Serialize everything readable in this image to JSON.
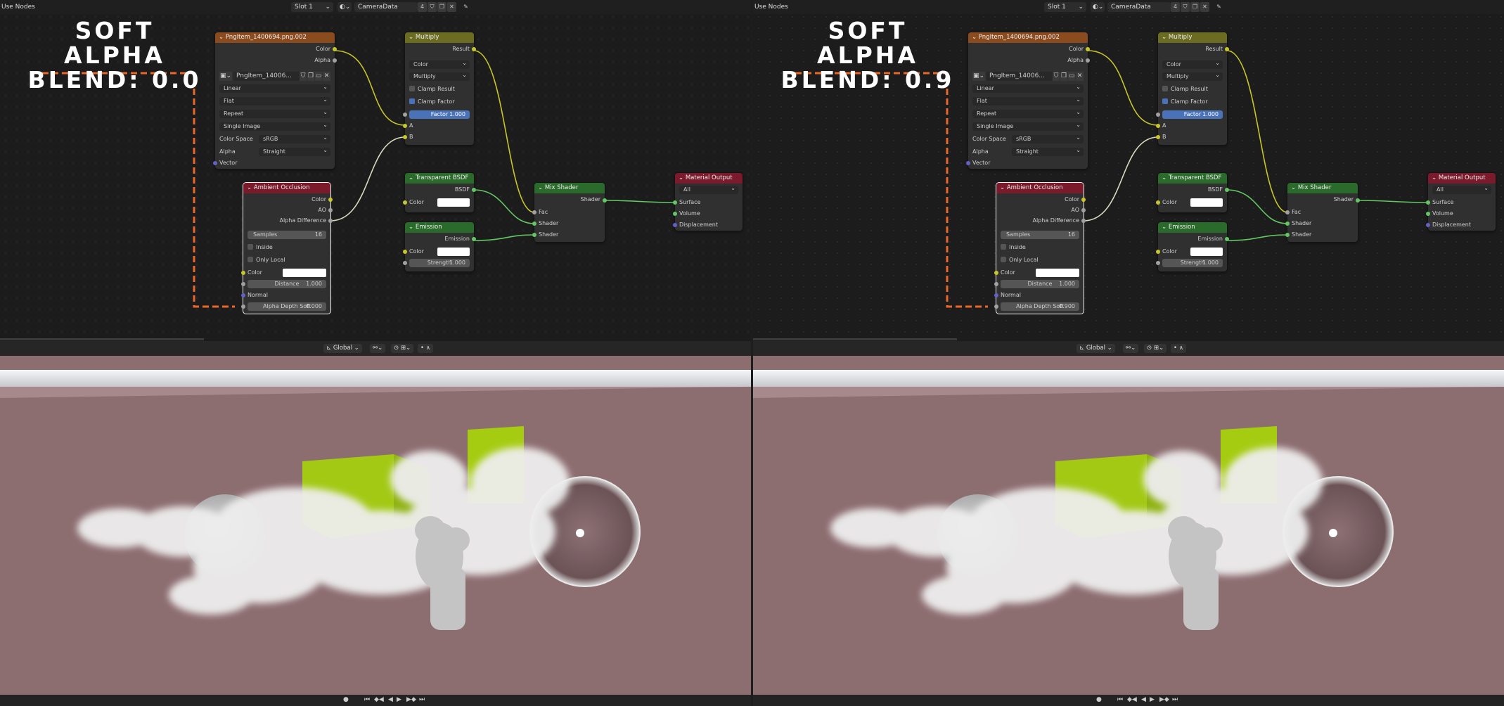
{
  "panels": [
    {
      "header": {
        "title": "Use Nodes",
        "slot": "Slot 1",
        "camera_data": "CameraData",
        "user_count": "4"
      },
      "overlay_text": [
        "SOFT ALPHA",
        "BLEND: 0.0"
      ],
      "image_node": {
        "title": "PngItem_1400694.png.002",
        "out_color": "Color",
        "out_alpha": "Alpha",
        "image_name": "PngItem_14006...",
        "interpolation": "Linear",
        "projection": "Flat",
        "extension": "Repeat",
        "source": "Single Image",
        "color_space_label": "Color Space",
        "color_space_value": "sRGB",
        "alpha_label": "Alpha",
        "alpha_value": "Straight",
        "in_vector": "Vector"
      },
      "multiply_node": {
        "title": "Multiply",
        "out_result": "Result",
        "type": "Color",
        "blend": "Multiply",
        "clamp_result": "Clamp Result",
        "clamp_factor": "Clamp Factor",
        "factor_label": "Factor",
        "factor_value": "1.000",
        "in_a": "A",
        "in_b": "B"
      },
      "ao_node": {
        "title": "Ambient Occlusion",
        "out_color": "Color",
        "out_ao": "AO",
        "out_alpha_diff": "Alpha Difference",
        "samples_label": "Samples",
        "samples_value": "16",
        "inside": "Inside",
        "only_local": "Only Local",
        "color_label": "Color",
        "distance_label": "Distance",
        "distance_value": "1.000",
        "normal": "Normal",
        "alpha_depth_label": "Alpha Depth Soft",
        "alpha_depth_value": "0.000"
      },
      "transparent_node": {
        "title": "Transparent BSDF",
        "out_bsdf": "BSDF",
        "color_label": "Color"
      },
      "emission_node": {
        "title": "Emission",
        "out_emission": "Emission",
        "color_label": "Color",
        "strength_label": "Strength",
        "strength_value": "1.000"
      },
      "mix_node": {
        "title": "Mix Shader",
        "out_shader": "Shader",
        "in_fac": "Fac",
        "in_shader1": "Shader",
        "in_shader2": "Shader"
      },
      "output_node": {
        "title": "Material Output",
        "target": "All",
        "in_surface": "Surface",
        "in_volume": "Volume",
        "in_displacement": "Displacement"
      },
      "viewport_header": {
        "orientation": "Global"
      }
    },
    {
      "header": {
        "title": "Use Nodes",
        "slot": "Slot 1",
        "camera_data": "CameraData",
        "user_count": "4"
      },
      "overlay_text": [
        "SOFT ALPHA",
        "BLEND: 0.9"
      ],
      "image_node": {
        "title": "PngItem_1400694.png.002",
        "out_color": "Color",
        "out_alpha": "Alpha",
        "image_name": "PngItem_14006...",
        "interpolation": "Linear",
        "projection": "Flat",
        "extension": "Repeat",
        "source": "Single Image",
        "color_space_label": "Color Space",
        "color_space_value": "sRGB",
        "alpha_label": "Alpha",
        "alpha_value": "Straight",
        "in_vector": "Vector"
      },
      "multiply_node": {
        "title": "Multiply",
        "out_result": "Result",
        "type": "Color",
        "blend": "Multiply",
        "clamp_result": "Clamp Result",
        "clamp_factor": "Clamp Factor",
        "factor_label": "Factor",
        "factor_value": "1.000",
        "in_a": "A",
        "in_b": "B"
      },
      "ao_node": {
        "title": "Ambient Occlusion",
        "out_color": "Color",
        "out_ao": "AO",
        "out_alpha_diff": "Alpha Difference",
        "samples_label": "Samples",
        "samples_value": "16",
        "inside": "Inside",
        "only_local": "Only Local",
        "color_label": "Color",
        "distance_label": "Distance",
        "distance_value": "1.000",
        "normal": "Normal",
        "alpha_depth_label": "Alpha Depth Soft",
        "alpha_depth_value": "0.900"
      },
      "transparent_node": {
        "title": "Transparent BSDF",
        "out_bsdf": "BSDF",
        "color_label": "Color"
      },
      "emission_node": {
        "title": "Emission",
        "out_emission": "Emission",
        "color_label": "Color",
        "strength_label": "Strength",
        "strength_value": "1.000"
      },
      "mix_node": {
        "title": "Mix Shader",
        "out_shader": "Shader",
        "in_fac": "Fac",
        "in_shader1": "Shader",
        "in_shader2": "Shader"
      },
      "output_node": {
        "title": "Material Output",
        "target": "All",
        "in_surface": "Surface",
        "in_volume": "Volume",
        "in_displacement": "Displacement"
      },
      "viewport_header": {
        "orientation": "Global"
      }
    }
  ],
  "colors": {
    "annotation_orange": "#e8682a",
    "image_header": "#8a4b1f",
    "converter_header": "#6b6b22",
    "shader_header": "#2a6a2a",
    "output_header": "#7a1a2a",
    "floor": "#8a6b6e",
    "cube": "#a6cc12"
  },
  "icons": [
    "chevron-down-icon",
    "material-sphere-icon",
    "shield-icon",
    "copy-icon",
    "close-icon",
    "pin-icon",
    "image-icon",
    "folder-icon",
    "play-icon",
    "jump-start-icon",
    "jump-end-icon",
    "keyframe-prev-icon",
    "keyframe-next-icon",
    "record-icon"
  ]
}
